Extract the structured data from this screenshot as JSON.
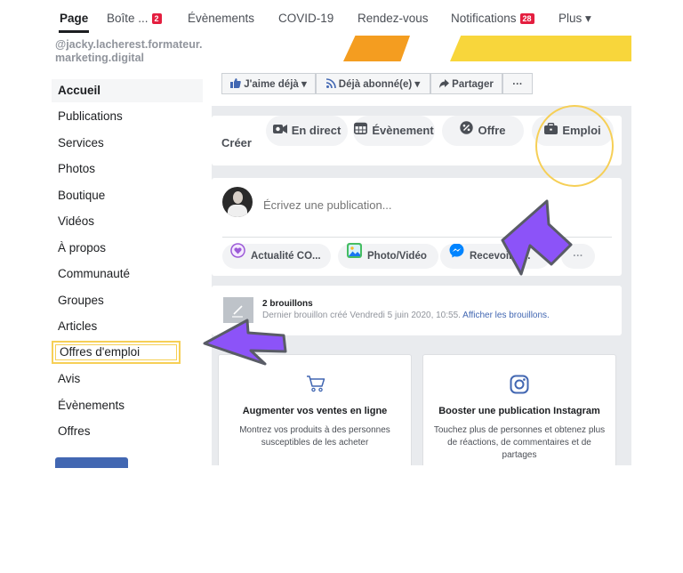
{
  "topnav": {
    "tabs": [
      {
        "label": "Page"
      },
      {
        "label": "Boîte ...",
        "badge": "2"
      },
      {
        "label": "Évènements"
      },
      {
        "label": "COVID-19"
      },
      {
        "label": "Rendez-vous"
      },
      {
        "label": "Notifications",
        "badge": "28"
      },
      {
        "label": "Plus ▾"
      }
    ]
  },
  "sidebar": {
    "handle": "@jacky.lacherest.formateur.marketing.digital",
    "items": [
      {
        "label": "Accueil"
      },
      {
        "label": "Publications"
      },
      {
        "label": "Services"
      },
      {
        "label": "Photos"
      },
      {
        "label": "Boutique"
      },
      {
        "label": "Vidéos"
      },
      {
        "label": "À propos"
      },
      {
        "label": "Communauté"
      },
      {
        "label": "Groupes"
      },
      {
        "label": "Articles"
      },
      {
        "label": "Offres d'emploi"
      },
      {
        "label": "Avis"
      },
      {
        "label": "Évènements"
      },
      {
        "label": "Offres"
      }
    ]
  },
  "actions": {
    "like": "J'aime déjà ▾",
    "follow": "Déjà abonné(e) ▾",
    "share": "Partager",
    "more": "···"
  },
  "create": {
    "label": "Créer",
    "live": "En direct",
    "event": "Évènement",
    "offer": "Offre",
    "job": "Emploi"
  },
  "composer": {
    "placeholder": "Écrivez une publication...",
    "covid": "Actualité CO...",
    "photo": "Photo/Vidéo",
    "messages": "Recevoir d...",
    "more": "···"
  },
  "drafts": {
    "title": "2 brouillons",
    "subtitle": "Dernier brouillon créé Vendredi 5 juin 2020, 10:55.",
    "link": "Afficher les brouillons."
  },
  "promos": [
    {
      "icon": "cart-icon",
      "title": "Augmenter vos ventes en ligne",
      "desc": "Montrez vos produits à des personnes susceptibles de les acheter"
    },
    {
      "icon": "instagram-icon",
      "title": "Booster une publication Instagram",
      "desc": "Touchez plus de personnes et obtenez plus de réactions, de commentaires et de partages"
    }
  ],
  "colors": {
    "accent": "#4267b2",
    "badge": "#e41e3f",
    "highlight_ring": "#f6cf56",
    "arrow": "#8c53f8",
    "messenger": "#0084ff"
  }
}
